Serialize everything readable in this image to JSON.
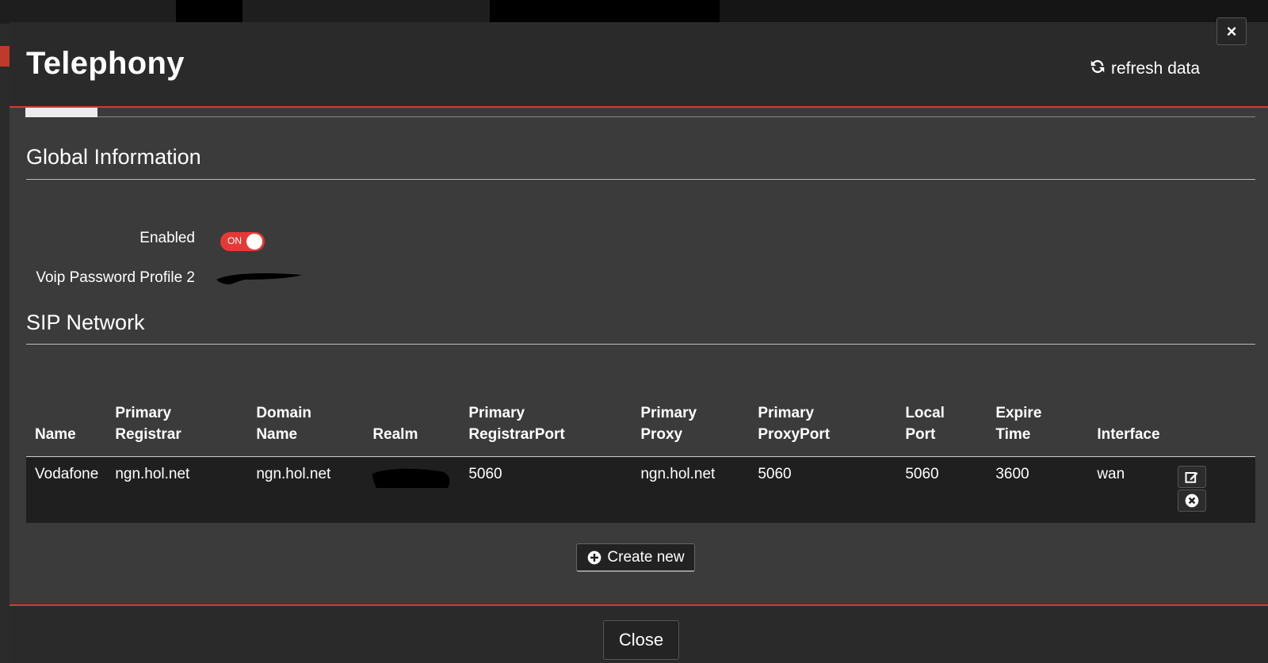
{
  "modal": {
    "title": "Telephony",
    "refresh_label": "refresh data",
    "close_x": "×"
  },
  "global": {
    "heading": "Global Information",
    "enabled_label": "Enabled",
    "enabled_state": "ON",
    "password_label": "Voip Password Profile 2"
  },
  "sip": {
    "heading": "SIP Network",
    "headers": [
      [
        "Name"
      ],
      [
        "Primary",
        "Registrar"
      ],
      [
        "Domain",
        "Name"
      ],
      [
        "Realm"
      ],
      [
        "Primary",
        "RegistrarPort"
      ],
      [
        "Primary",
        "Proxy"
      ],
      [
        "Primary",
        "ProxyPort"
      ],
      [
        "Local",
        "Port"
      ],
      [
        "Expire",
        "Time"
      ],
      [
        "Interface"
      ]
    ],
    "rows": [
      {
        "name": "Vodafone",
        "primary_registrar": "ngn.hol.net",
        "domain_name": "ngn.hol.net",
        "primary_registrar_port": "5060",
        "primary_proxy": "ngn.hol.net",
        "primary_proxy_port": "5060",
        "local_port": "5060",
        "expire_time": "3600",
        "interface": "wan"
      }
    ],
    "create_label": "Create new"
  },
  "footer": {
    "close_label": "Close"
  },
  "colors": {
    "accent": "#d63a2f",
    "toggle_on": "#e53935"
  }
}
